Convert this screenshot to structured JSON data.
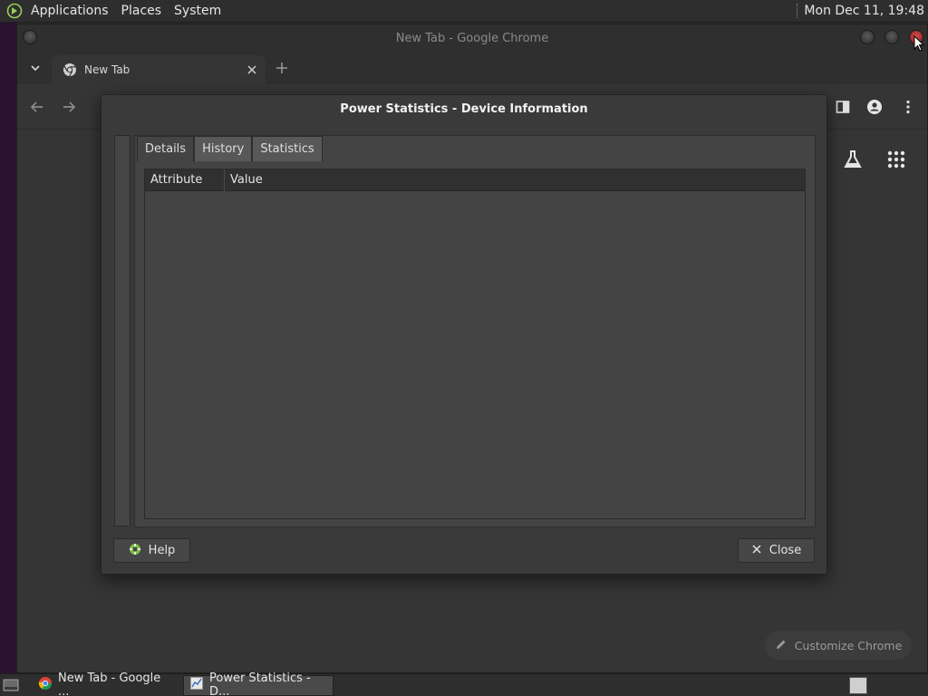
{
  "top_panel": {
    "menus": [
      "Applications",
      "Places",
      "System"
    ],
    "clock": "Mon Dec 11, 19:48"
  },
  "chrome": {
    "window_title": "New Tab - Google Chrome",
    "tab_title": "New Tab",
    "customize_label": "Customize Chrome"
  },
  "dialog": {
    "title": "Power Statistics - Device Information",
    "tabs": [
      "Details",
      "History",
      "Statistics"
    ],
    "active_tab": "Details",
    "columns": [
      "Attribute",
      "Value"
    ],
    "help_label": "Help",
    "close_label": "Close"
  },
  "taskbar": {
    "items": [
      "New Tab - Google ...",
      "Power Statistics - D..."
    ]
  },
  "colors": {
    "panel_bg": "#2e2e2e",
    "window_bg": "#353535",
    "dialog_bg": "#3a3a3a",
    "wm_close": "#d84a4a"
  },
  "icons": {
    "menu_logo": "mate-logo-icon",
    "tab_favicon": "chrome-icon",
    "help": "lifebuoy-icon",
    "close": "x-icon"
  }
}
